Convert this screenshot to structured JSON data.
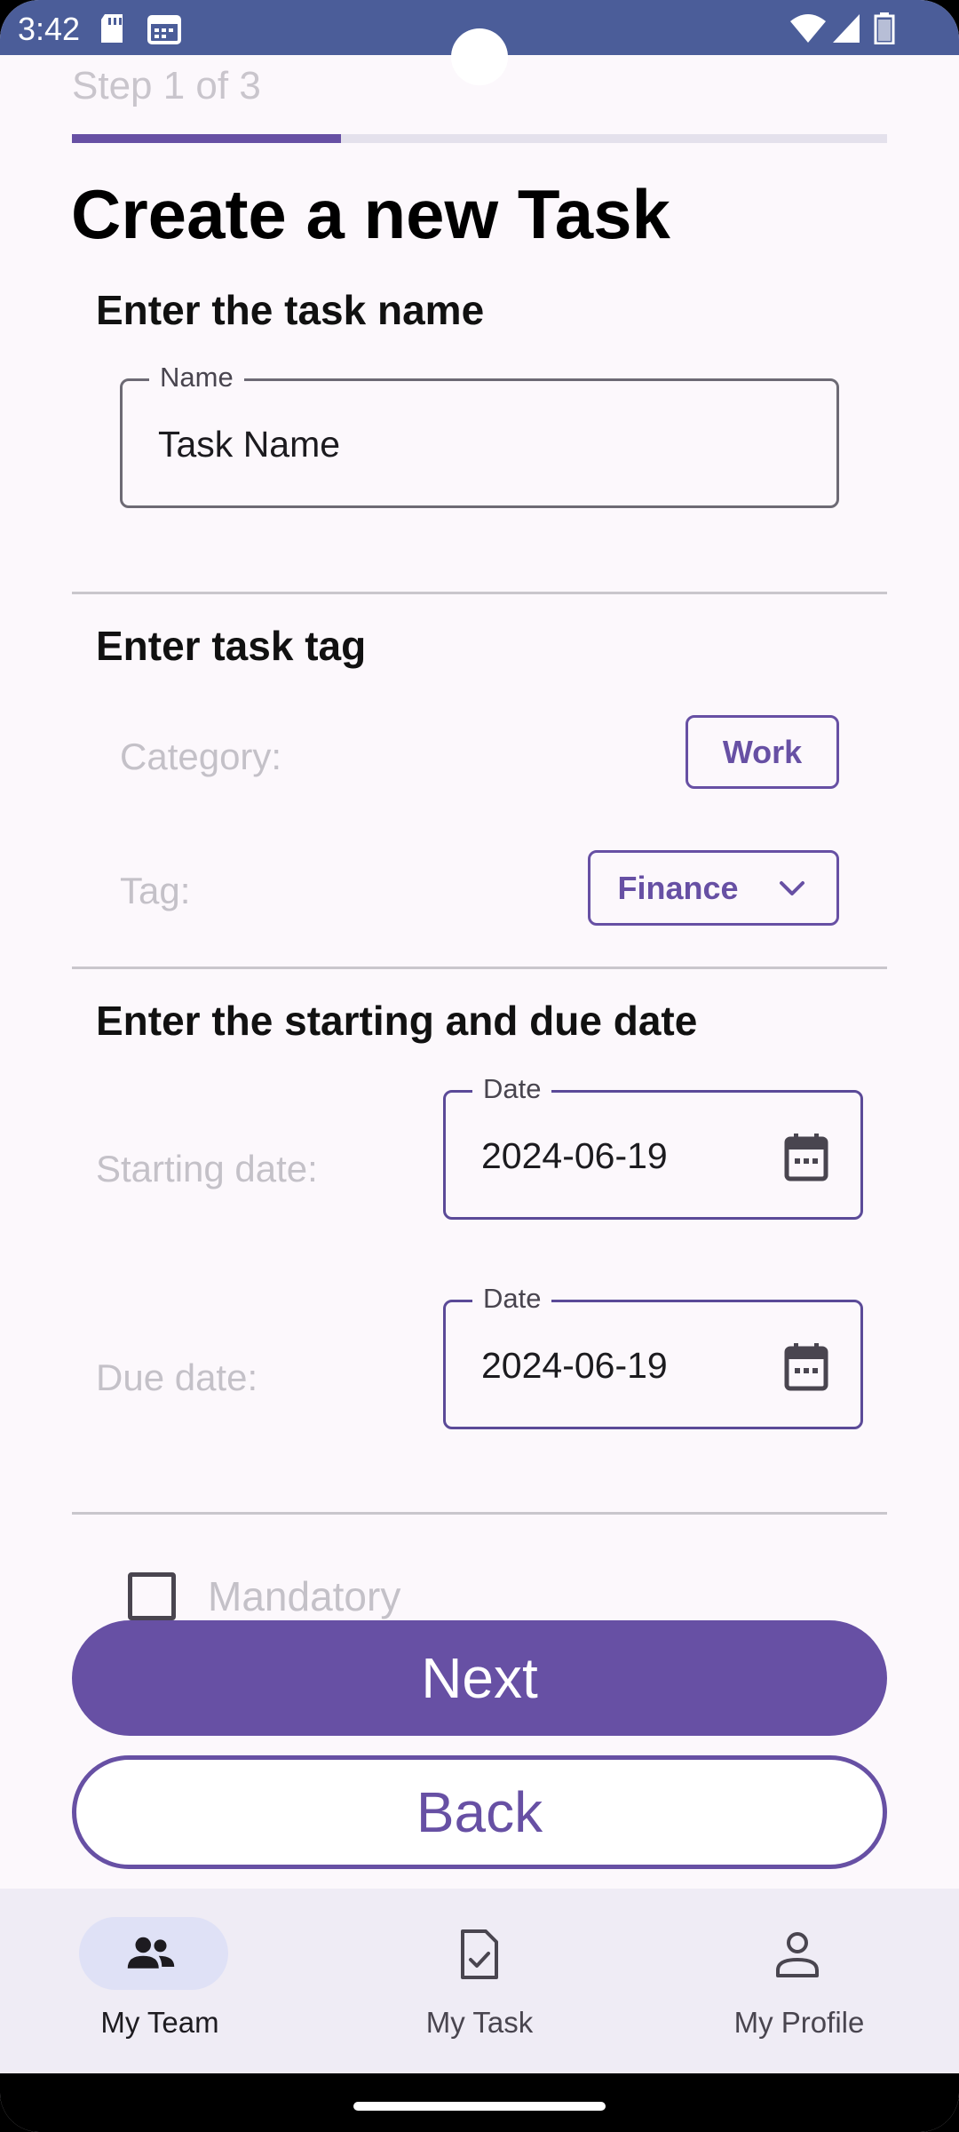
{
  "status_bar": {
    "time": "3:42",
    "icons": [
      "sd-card-icon",
      "calendar-icon",
      "wifi-icon",
      "signal-icon",
      "battery-icon"
    ],
    "background": "#4b5d99"
  },
  "wizard": {
    "step_text": "Step 1 of 3",
    "progress_fraction": 0.33
  },
  "page": {
    "title": "Create a new Task"
  },
  "name_section": {
    "title": "Enter the task name",
    "field_label": "Name",
    "field_value": "Task Name"
  },
  "tag_section": {
    "title": "Enter task tag",
    "category_label": "Category:",
    "category_value": "Work",
    "tag_label": "Tag:",
    "tag_value": "Finance"
  },
  "date_section": {
    "title": "Enter the starting and due date",
    "start_label": "Starting date:",
    "start_field_label": "Date",
    "start_value": "2024-06-19",
    "due_label": "Due date:",
    "due_field_label": "Date",
    "due_value": "2024-06-19"
  },
  "mandatory": {
    "label": "Mandatory",
    "checked": false
  },
  "buttons": {
    "next": "Next",
    "back": "Back"
  },
  "bottom_nav": {
    "items": [
      {
        "label": "My Team",
        "icon": "group-icon",
        "active": true
      },
      {
        "label": "My Task",
        "icon": "task-check-icon",
        "active": false
      },
      {
        "label": "My Profile",
        "icon": "person-icon",
        "active": false
      }
    ]
  },
  "colors": {
    "primary": "#6750a4",
    "surface": "#fcf8fc",
    "nav_background": "#efecf5",
    "active_indicator": "#dfe1f6"
  }
}
